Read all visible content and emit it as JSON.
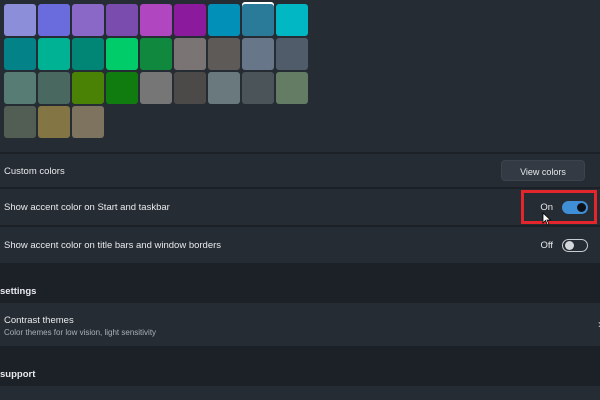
{
  "colors": {
    "swatches_row1": [
      "#8c8ed9",
      "#6a6cde",
      "#8a68c8",
      "#7a4cad",
      "#b047c1",
      "#8b1a9c",
      "#0090b8",
      "#2a7a9a",
      "#00b7c3"
    ],
    "swatches_row2": [
      "#038387",
      "#00b294",
      "#018574",
      "#00cc6a",
      "#10893e",
      "#7a7574",
      "#5d5a58",
      "#68768a",
      "#515c6b"
    ],
    "swatches_row3": [
      "#567c73",
      "#486860",
      "#498205",
      "#107c10",
      "#767676",
      "#4c4a48",
      "#69797e",
      "#4a5459",
      "#647c64"
    ],
    "swatches_row4": [
      "#525e54",
      "#847545",
      "#7e735f"
    ],
    "accent_toggle": "#3f8ed6",
    "highlight": "#e3262b"
  },
  "custom_colors": {
    "label": "Custom colors",
    "button": "View colors"
  },
  "accent_start": {
    "label": "Show accent color on Start and taskbar",
    "state": "On"
  },
  "accent_title": {
    "label": "Show accent color on title bars and window borders",
    "state": "Off"
  },
  "sections": {
    "settings": "settings",
    "support": "support"
  },
  "contrast": {
    "title": "Contrast themes",
    "subtitle": "Color themes for low vision, light sensitivity",
    "chevron": "›"
  }
}
